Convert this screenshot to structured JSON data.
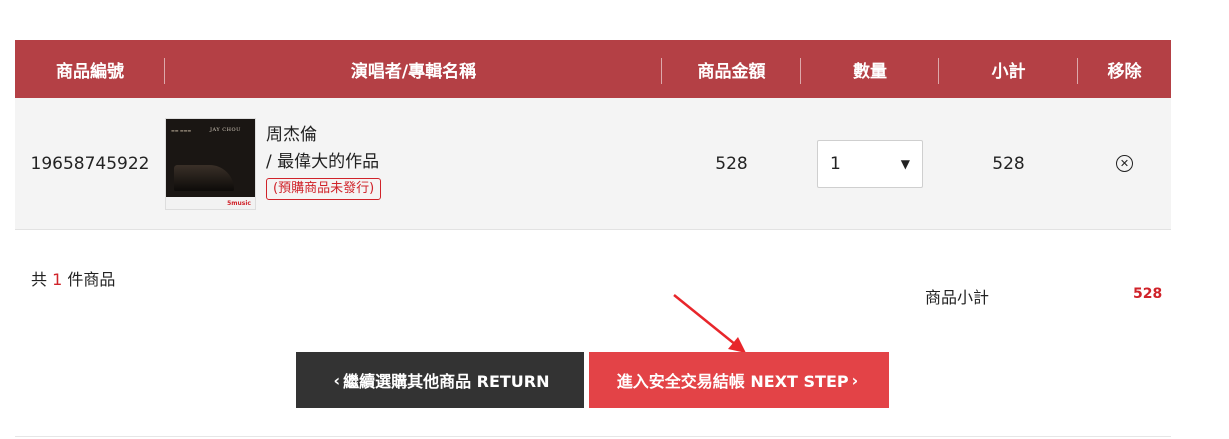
{
  "table": {
    "headers": {
      "id": "商品編號",
      "name": "演唱者/專輯名稱",
      "price": "商品金額",
      "qty": "數量",
      "subtotal": "小計",
      "remove": "移除"
    },
    "row": {
      "id": "19658745922",
      "artist": "周杰倫",
      "album": "/ 最偉大的作品",
      "badge": "(預購商品未發行)",
      "price": "528",
      "qty": "1",
      "subtotal": "528",
      "cover_text": "JAY CHOU",
      "cover_brand": "5music"
    }
  },
  "summary": {
    "count_prefix": "共",
    "count": "1",
    "count_suffix": "件商品",
    "subtotal_label": "商品小計",
    "subtotal_value": "528"
  },
  "buttons": {
    "return_label": "繼續選購其他商品 RETURN",
    "next_label": "進入安全交易結帳 NEXT STEP"
  },
  "colors": {
    "header_bg": "#b44045",
    "accent_red": "#d0232a",
    "next_button": "#e34347",
    "return_button": "#333333",
    "annotation_arrow": "#e8262b"
  }
}
